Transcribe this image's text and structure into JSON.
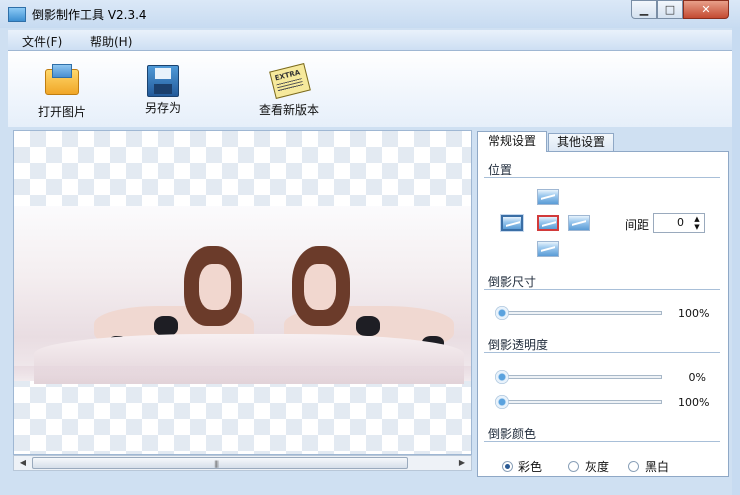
{
  "window": {
    "title": "倒影制作工具 V2.3.4",
    "min_symbol": "▁",
    "max_symbol": "□",
    "close_symbol": "✕"
  },
  "menu": {
    "file": "文件(F)",
    "help": "帮助(H)"
  },
  "toolbar": {
    "open_label": "打开图片",
    "saveas_label": "另存为",
    "news_label": "查看新版本"
  },
  "scrollbar": {
    "left_arrow": "◀",
    "right_arrow": "▶",
    "grip": "|||"
  },
  "tabs": {
    "general": "常规设置",
    "other": "其他设置"
  },
  "position": {
    "title": "位置",
    "spacing_label": "间距",
    "spacing_value": "0",
    "spin_up": "▲",
    "spin_down": "▼"
  },
  "size": {
    "title": "倒影尺寸",
    "value": "100%",
    "level": 0
  },
  "opacity": {
    "title": "倒影透明度",
    "start_value": "0%",
    "end_value": "100%",
    "start_level": 0,
    "end_level": 0
  },
  "color": {
    "title": "倒影颜色",
    "options": [
      "彩色",
      "灰度",
      "黑白"
    ],
    "selected": "彩色"
  },
  "colors": {
    "accent": "#2a5a94",
    "selected_border": "#d23a3a",
    "close_button": "#c44b32"
  }
}
